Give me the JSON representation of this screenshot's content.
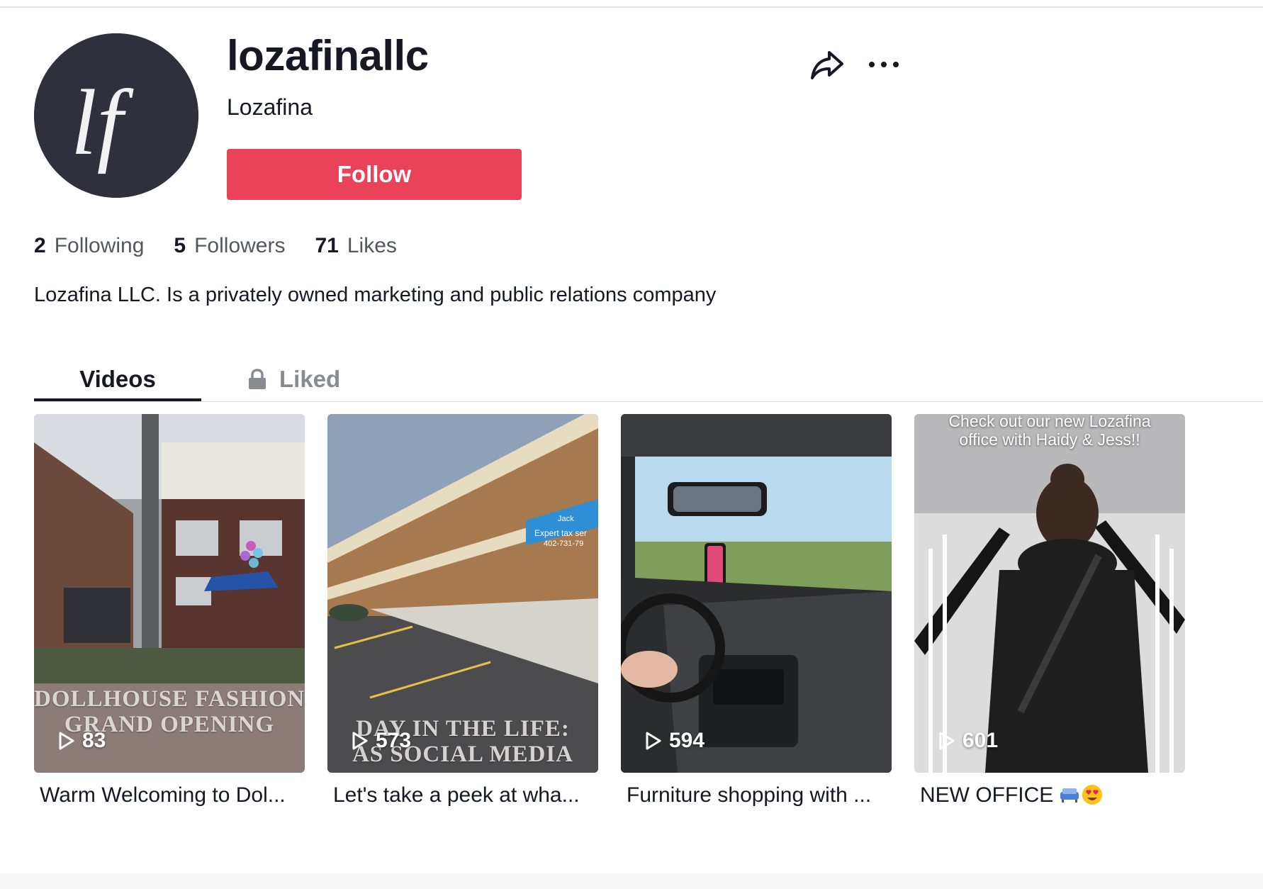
{
  "profile": {
    "avatar_initials": "lf",
    "username": "lozafinallc",
    "nickname": "Lozafina",
    "follow_label": "Follow",
    "bio": "Lozafina LLC. Is a privately owned marketing and public relations company"
  },
  "stats": {
    "following_count": "2",
    "following_label": "Following",
    "followers_count": "5",
    "followers_label": "Followers",
    "likes_count": "71",
    "likes_label": "Likes"
  },
  "actions": {
    "share_icon": "share-arrow-icon",
    "more_icon": "ellipsis-icon"
  },
  "tabs": {
    "videos": "Videos",
    "liked": "Liked",
    "active": "Videos"
  },
  "videos": [
    {
      "views": "83",
      "caption": "Warm Welcoming to Dol...",
      "overlay_line1": "DOLLHOUSE FASHION",
      "overlay_line2": "GRAND OPENING"
    },
    {
      "views": "573",
      "caption": "Let's take a peek at wha...",
      "overlay_line1": "DAY IN THE LIFE:",
      "overlay_line2": "AS SOCIAL MEDIA",
      "sign_line1": "Jack",
      "sign_line2": "Expert tax ser",
      "sign_line3": "402-731-79"
    },
    {
      "views": "594",
      "caption": "Furniture shopping with ..."
    },
    {
      "views": "601",
      "caption": "NEW OFFICE",
      "top_line1": "Check out our new Lozafina",
      "top_line2": "office with Haidy & Jess!!"
    }
  ],
  "colors": {
    "accent": "#ea4359",
    "avatar_bg": "#2e303b",
    "text": "#161823",
    "muted": "#8a8b91"
  }
}
